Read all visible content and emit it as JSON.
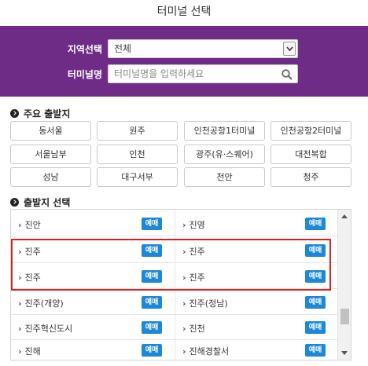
{
  "page": {
    "title": "터미널 선택"
  },
  "form": {
    "region_label": "지역선택",
    "region_value": "전체",
    "terminal_label": "터미널명",
    "terminal_placeholder": "터미널명을 입력하세요"
  },
  "major": {
    "title": "주요 출발지",
    "items": [
      "동서울",
      "원주",
      "인천공항1터미널",
      "인천공항2터미널",
      "서울남부",
      "인천",
      "광주(유·스퀘어)",
      "대전복합",
      "성남",
      "대구서부",
      "천안",
      "청주"
    ]
  },
  "depart": {
    "title": "출발지 선택",
    "book_label": "예매",
    "rows": [
      [
        "진안",
        "진영"
      ],
      [
        "진주",
        "진주"
      ],
      [
        "진주",
        "진주"
      ],
      [
        "진주(개양)",
        "진주(정남)"
      ],
      [
        "진주혁신도시",
        "진천"
      ],
      [
        "진해",
        "진해경찰서"
      ]
    ]
  },
  "colors": {
    "header_purple": "#6f2c87",
    "book_blue": "#1e88d8",
    "highlight_red": "#e02020"
  }
}
